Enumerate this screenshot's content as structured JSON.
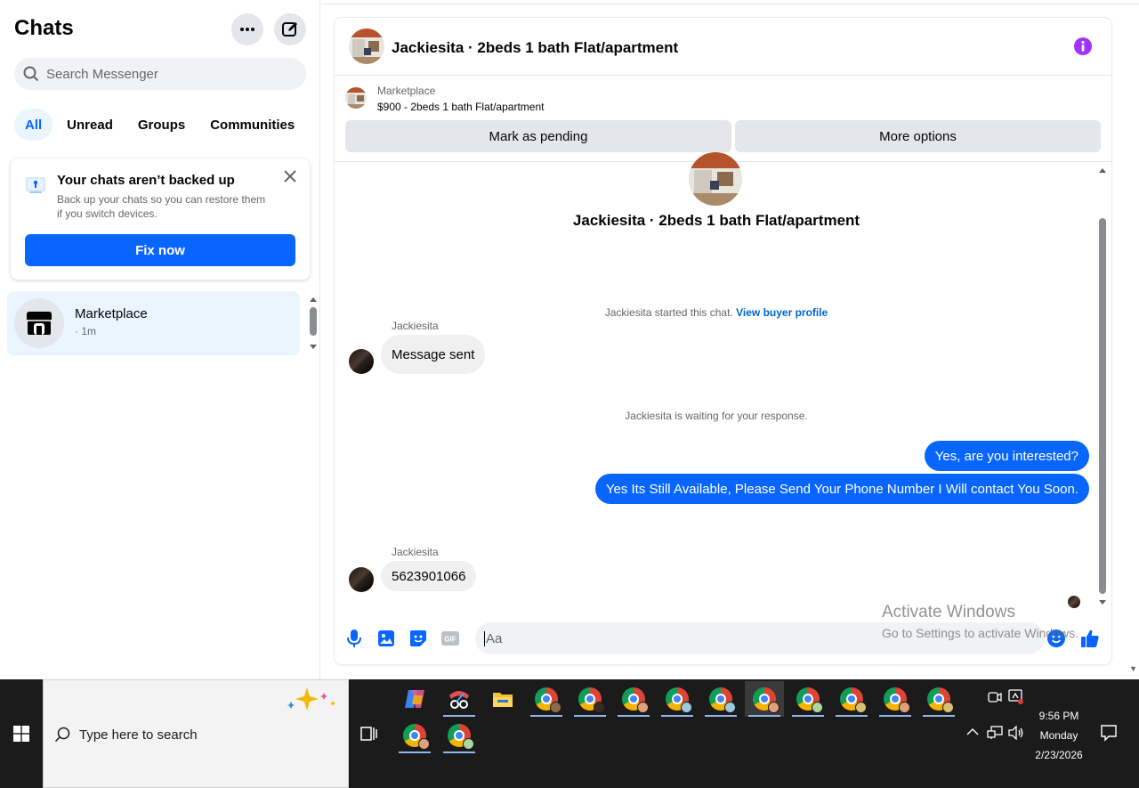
{
  "sidebar": {
    "title": "Chats",
    "search_placeholder": "Search Messenger",
    "tabs": [
      "All",
      "Unread",
      "Groups",
      "Communities"
    ],
    "backup": {
      "title": "Your chats aren’t backed up",
      "description": "Back up your chats so you can restore them if you switch devices.",
      "button": "Fix now"
    },
    "conversations": [
      {
        "name": "Marketplace",
        "time": "· 1m"
      }
    ]
  },
  "chat": {
    "header_title": "Jackiesita · 2beds 1 bath Flat/apartment",
    "marketplace_label": "Marketplace",
    "listing": "$900 - 2beds 1 bath Flat/apartment",
    "mark_pending": "Mark as pending",
    "more_options": "More options",
    "intro_title": "Jackiesita · 2beds 1 bath Flat/apartment",
    "started_text": "Jackiesita started this chat.",
    "view_profile": "View buyer profile",
    "waiting_text": "Jackiesita is waiting for your response.",
    "messages": [
      {
        "from": "Jackiesita",
        "text": "Message sent"
      },
      {
        "from": "me",
        "text": "Yes, are you interested?"
      },
      {
        "from": "me",
        "text": "Yes Its Still Available, Please Send Your Phone Number I Will contact You Soon."
      },
      {
        "from": "Jackiesita",
        "text": "5623901066"
      }
    ],
    "composer_placeholder": "Aa"
  },
  "watermark": {
    "line1": "Activate Windows",
    "line2": "Go to Settings to activate Windows."
  },
  "taskbar": {
    "search_placeholder": "Type here to search",
    "time": "9:56 PM",
    "day": "Monday",
    "date": "2/23/2026"
  },
  "colors": {
    "accent": "#0866ff",
    "info_purple": "#a033ff",
    "taskbar": "#1b1b1b"
  }
}
